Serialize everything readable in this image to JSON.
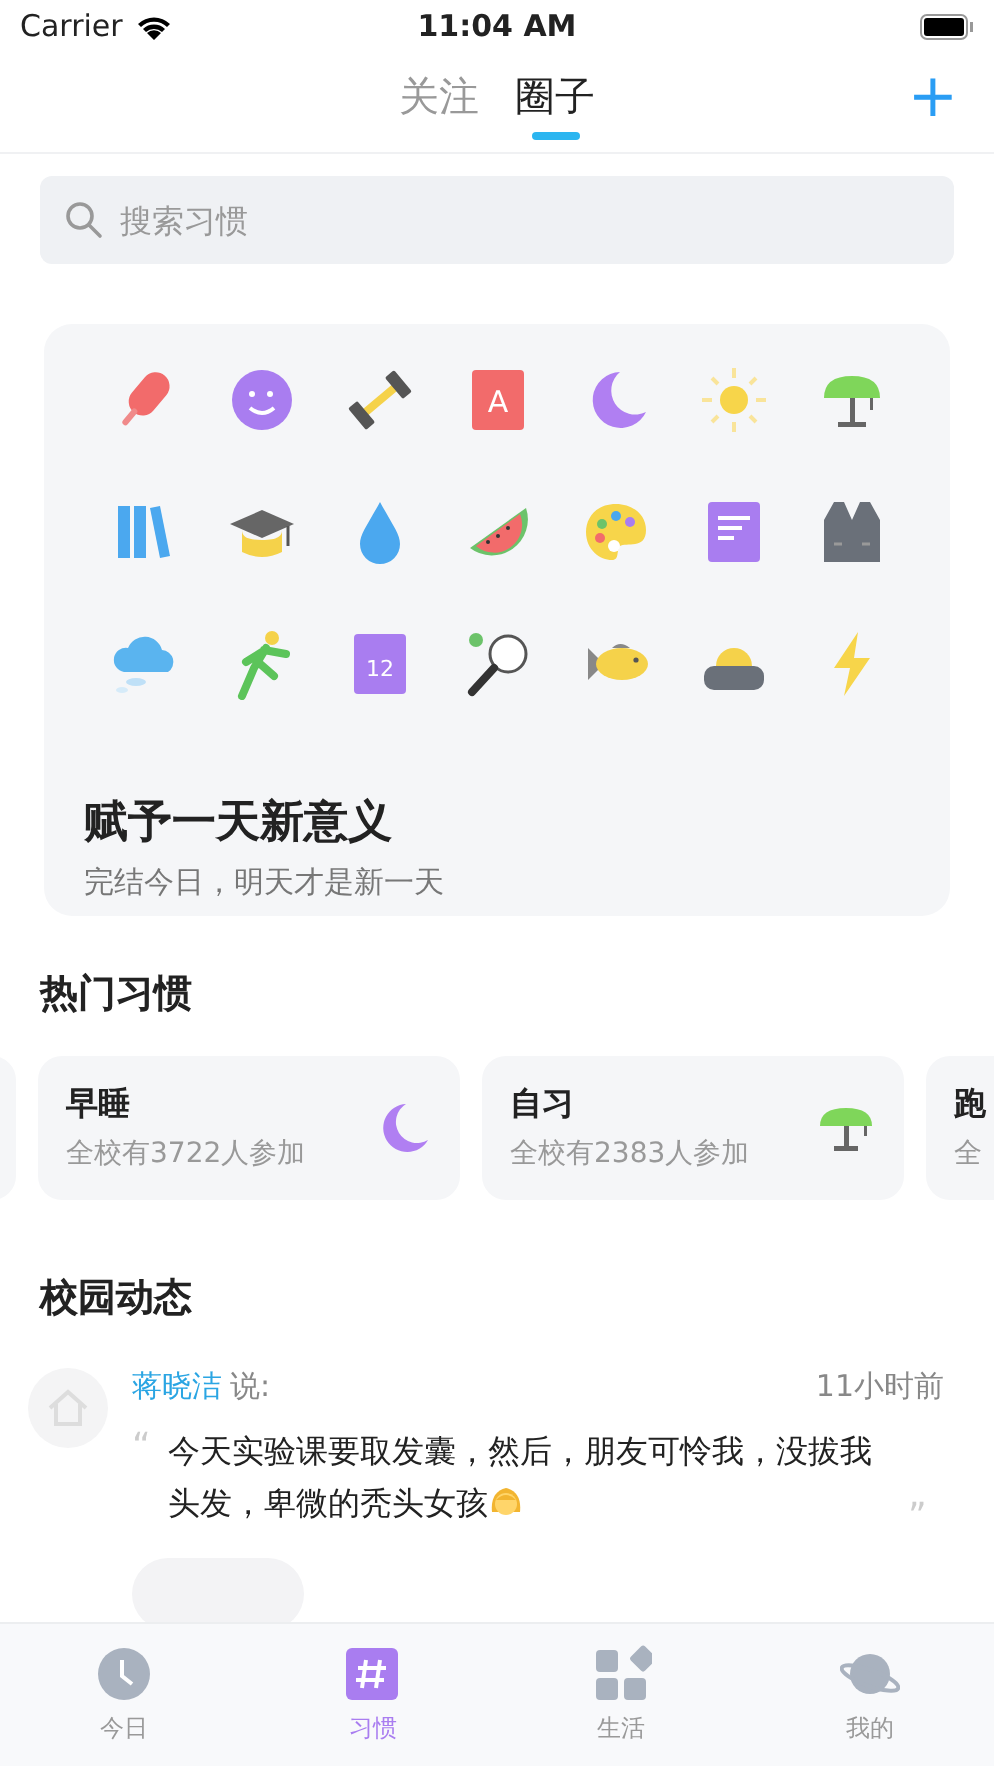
{
  "status_bar": {
    "carrier": "Carrier",
    "time": "11:04 AM"
  },
  "header": {
    "tabs": [
      {
        "label": "关注",
        "selected": false
      },
      {
        "label": "圈子",
        "selected": true
      }
    ],
    "add": "+"
  },
  "search": {
    "placeholder": "搜索习惯"
  },
  "banner": {
    "book_letter": "A",
    "calendar_day": "12",
    "title": "赋予一天新意义",
    "subtitle": "完结今日，明天才是新一天"
  },
  "hot_habits": {
    "title": "热门习惯",
    "cards": [
      {
        "kind": "partial"
      },
      {
        "kind": "moon",
        "name": "早睡",
        "count": "全校有3722人参加"
      },
      {
        "kind": "lamp",
        "name": "自习",
        "count": "全校有2383人参加"
      },
      {
        "kind": "cut",
        "name": "跑",
        "count": "全"
      }
    ]
  },
  "campus_feed": {
    "title": "校园动态",
    "posts": [
      {
        "user": "蒋晓洁",
        "says": "说:",
        "time": "11小时前",
        "open_quote": "“",
        "text": "今天实验课要取发囊，然后，朋友可怜我，没拔我头发，卑微的秃头女孩",
        "close_quote": "”"
      }
    ]
  },
  "tab_bar": [
    {
      "kind": "clock",
      "label": "今日",
      "selected": false
    },
    {
      "kind": "hash",
      "label": "习惯",
      "selected": true
    },
    {
      "kind": "grid",
      "label": "生活",
      "selected": false
    },
    {
      "kind": "planet",
      "label": "我的",
      "selected": false
    }
  ]
}
